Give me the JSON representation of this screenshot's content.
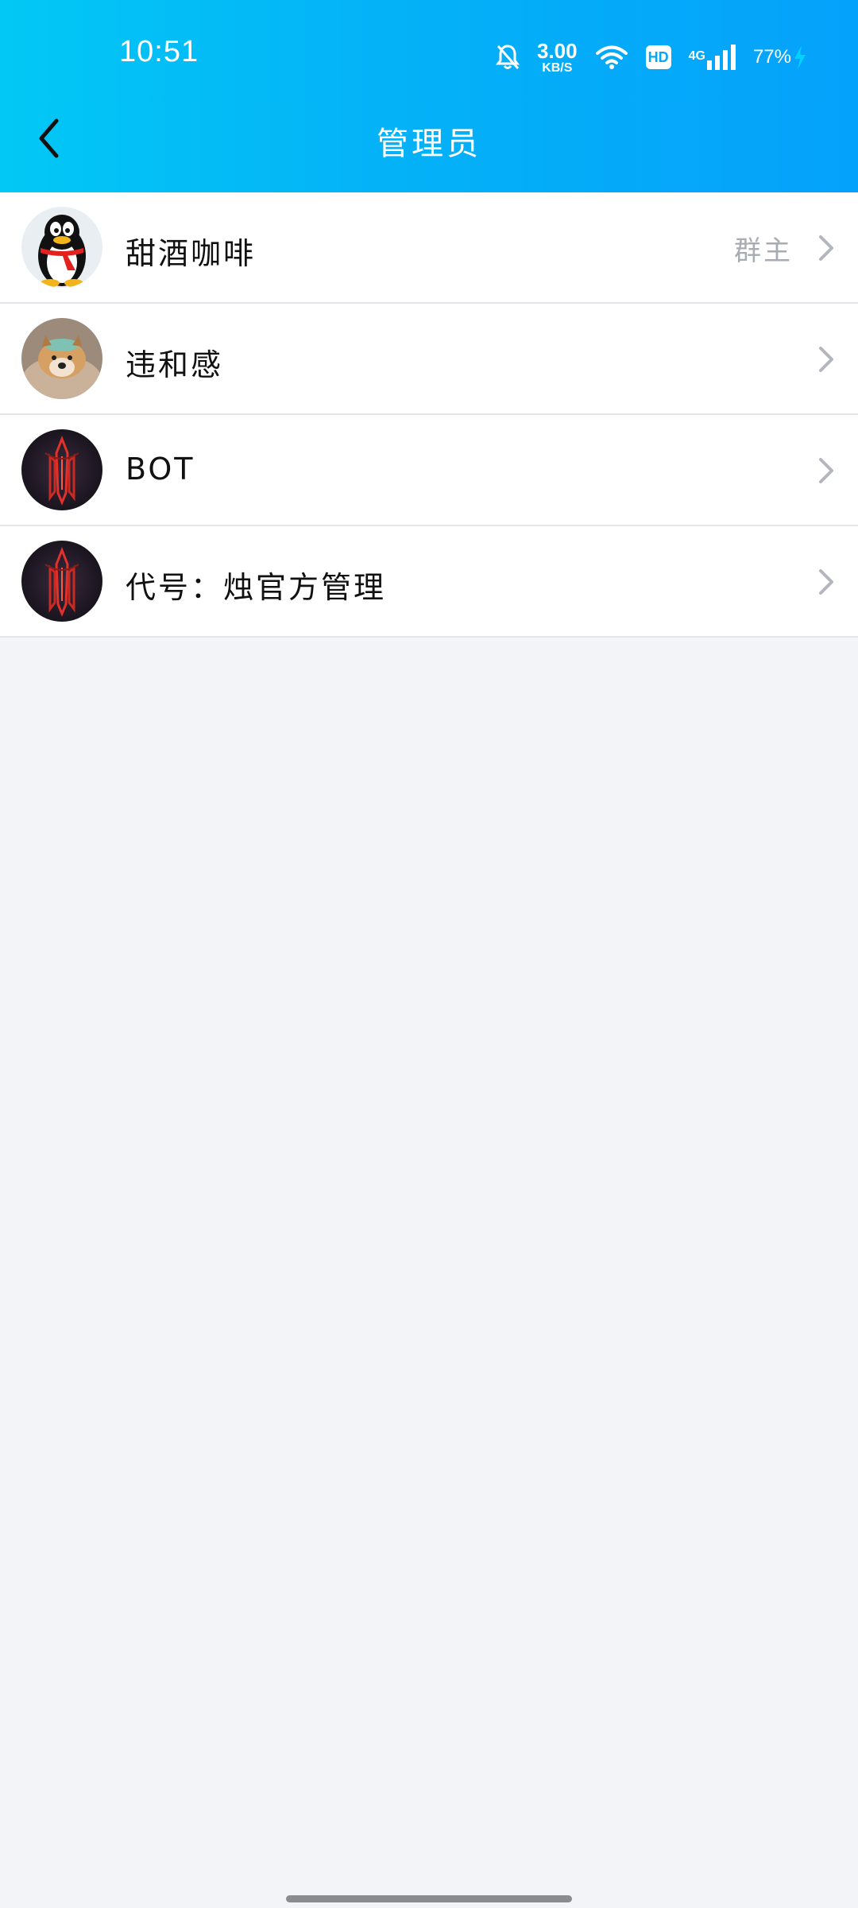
{
  "status_bar": {
    "time": "10:51",
    "network_speed_value": "3.00",
    "network_speed_unit": "KB/S",
    "hd_label": "HD",
    "network_type": "4G",
    "battery_percent": "77%",
    "icons": [
      "bell-muted-icon",
      "wifi-icon",
      "hd-icon",
      "signal-icon",
      "battery-charging-icon"
    ]
  },
  "nav": {
    "title": "管理员",
    "back_icon": "chevron-left-icon"
  },
  "admins": [
    {
      "name": "甜酒咖啡",
      "role": "群主",
      "avatar": "penguin-avatar"
    },
    {
      "name": "违和感",
      "role": "",
      "avatar": "dog-avatar"
    },
    {
      "name": "BOT",
      "role": "",
      "avatar": "dark-emblem-avatar"
    },
    {
      "name": "代号：烛官方管理",
      "role": "",
      "avatar": "dark-emblem-avatar"
    }
  ],
  "colors": {
    "header_gradient_start": "#02c8f5",
    "header_gradient_end": "#05a2fb",
    "background": "#f3f4f8",
    "divider": "#e4e5ea",
    "secondary_text": "#a8abb4"
  }
}
